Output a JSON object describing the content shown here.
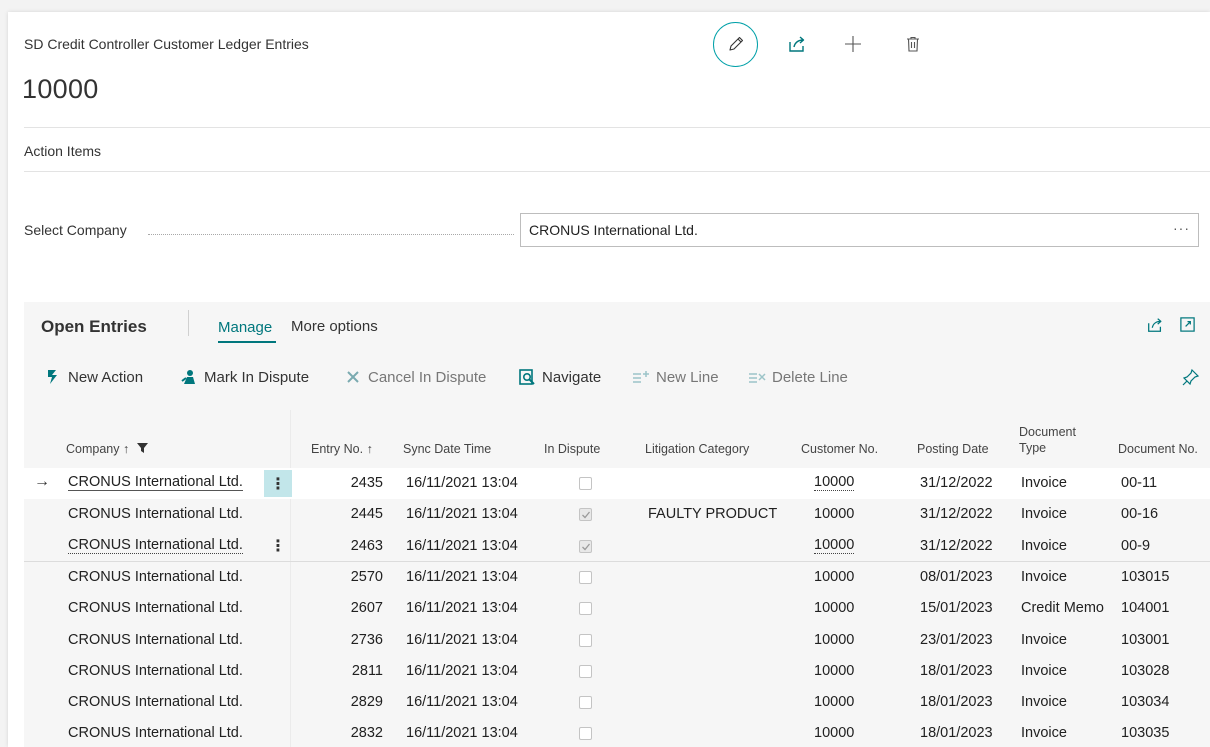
{
  "header": {
    "caption": "SD Credit Controller Customer Ledger Entries",
    "record_title": "10000"
  },
  "action_items": "Action Items",
  "select_company": {
    "label": "Select Company",
    "value": "CRONUS International Ltd.",
    "more": "···"
  },
  "part": {
    "title": "Open Entries",
    "tabs": {
      "manage": "Manage",
      "more": "More options"
    },
    "toolbar": {
      "new_action": "New Action",
      "mark_in_dispute": "Mark In Dispute",
      "cancel_in_dispute": "Cancel In Dispute",
      "navigate": "Navigate",
      "new_line": "New Line",
      "delete_line": "Delete Line"
    }
  },
  "columns": {
    "company": "Company ↑",
    "entry_no": "Entry No. ↑",
    "sync": "Sync Date Time",
    "in_dispute": "In Dispute",
    "litigation": "Litigation Category",
    "customer_no": "Customer No.",
    "posting_date": "Posting Date",
    "doc_type_1": "Document",
    "doc_type_2": "Type",
    "doc_no": "Document No."
  },
  "rows": [
    {
      "company": "CRONUS International Ltd.",
      "entry_no": "2435",
      "sync": "16/11/2021 13:04",
      "in_dispute": false,
      "litigation": "",
      "customer_no": "10000",
      "posting_date": "31/12/2022",
      "doc_type": "Invoice",
      "doc_no": "00-11"
    },
    {
      "company": "CRONUS International Ltd.",
      "entry_no": "2445",
      "sync": "16/11/2021 13:04",
      "in_dispute": true,
      "litigation": "FAULTY PRODUCT",
      "customer_no": "10000",
      "posting_date": "31/12/2022",
      "doc_type": "Invoice",
      "doc_no": "00-16"
    },
    {
      "company": "CRONUS International Ltd.",
      "entry_no": "2463",
      "sync": "16/11/2021 13:04",
      "in_dispute": true,
      "litigation": "",
      "customer_no": "10000",
      "posting_date": "31/12/2022",
      "doc_type": "Invoice",
      "doc_no": "00-9"
    },
    {
      "company": "CRONUS International Ltd.",
      "entry_no": "2570",
      "sync": "16/11/2021 13:04",
      "in_dispute": false,
      "litigation": "",
      "customer_no": "10000",
      "posting_date": "08/01/2023",
      "doc_type": "Invoice",
      "doc_no": "103015"
    },
    {
      "company": "CRONUS International Ltd.",
      "entry_no": "2607",
      "sync": "16/11/2021 13:04",
      "in_dispute": false,
      "litigation": "",
      "customer_no": "10000",
      "posting_date": "15/01/2023",
      "doc_type": "Credit Memo",
      "doc_no": "104001"
    },
    {
      "company": "CRONUS International Ltd.",
      "entry_no": "2736",
      "sync": "16/11/2021 13:04",
      "in_dispute": false,
      "litigation": "",
      "customer_no": "10000",
      "posting_date": "23/01/2023",
      "doc_type": "Invoice",
      "doc_no": "103001"
    },
    {
      "company": "CRONUS International Ltd.",
      "entry_no": "2811",
      "sync": "16/11/2021 13:04",
      "in_dispute": false,
      "litigation": "",
      "customer_no": "10000",
      "posting_date": "18/01/2023",
      "doc_type": "Invoice",
      "doc_no": "103028"
    },
    {
      "company": "CRONUS International Ltd.",
      "entry_no": "2829",
      "sync": "16/11/2021 13:04",
      "in_dispute": false,
      "litigation": "",
      "customer_no": "10000",
      "posting_date": "18/01/2023",
      "doc_type": "Invoice",
      "doc_no": "103034"
    },
    {
      "company": "CRONUS International Ltd.",
      "entry_no": "2832",
      "sync": "16/11/2021 13:04",
      "in_dispute": false,
      "litigation": "",
      "customer_no": "10000",
      "posting_date": "18/01/2023",
      "doc_type": "Invoice",
      "doc_no": "103035"
    }
  ],
  "colors": {
    "accent": "#00a0a8",
    "link": "#00777d",
    "selection": "#c2e6ea"
  },
  "icons": [
    "edit-icon",
    "share-icon",
    "plus-icon",
    "trash-icon",
    "filter-icon",
    "expand-icon",
    "pin-icon",
    "row-arrow-icon",
    "kebab-icon",
    "checkbox-checked-icon"
  ]
}
